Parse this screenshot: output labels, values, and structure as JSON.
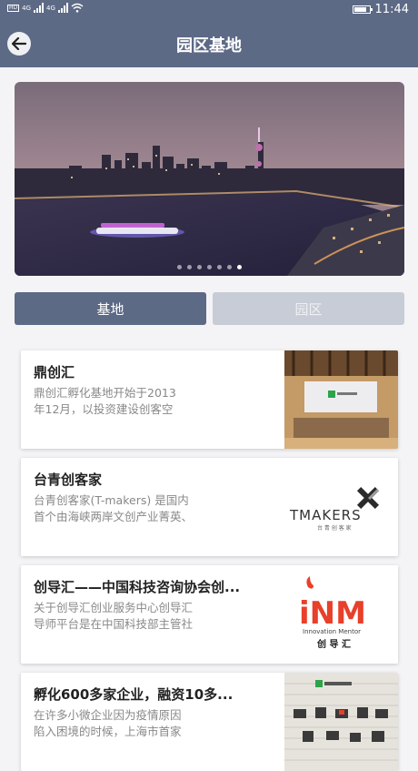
{
  "status_bar": {
    "hd_label": "HD",
    "network_1": "4G",
    "network_2": "4G",
    "time": "11:44"
  },
  "header": {
    "title": "园区基地",
    "back_icon": "arrow-left-icon"
  },
  "banner": {
    "slide_count": 7,
    "active_index": 6
  },
  "tabs": [
    {
      "label": "基地",
      "active": true
    },
    {
      "label": "园区",
      "active": false
    }
  ],
  "cards": [
    {
      "title": "鼎创汇",
      "desc_line1": "鼎创汇孵化基地开始于2013",
      "desc_line2": "年12月，以投资建设创客空"
    },
    {
      "title": "台青创客家",
      "desc_line1": "台青创客家(T-makers) 是国内",
      "desc_line2": "首个由海峡两岸文创产业菁英、",
      "logo_text": "TMAKERS",
      "logo_sub": "台 青 创 客 家"
    },
    {
      "title": "创导汇——中国科技咨询协会创...",
      "desc_line1": "关于创导汇创业服务中心创导汇",
      "desc_line2": "导师平台是在中国科技部主管社",
      "logo_text": "iNM",
      "logo_sub": "Innovation Mentor",
      "logo_cn": "创 导 汇"
    },
    {
      "title": "孵化600多家企业，融资10多...",
      "desc_line1": "在许多小微企业因为疫情原因",
      "desc_line2": "陷入困境的时候，上海市首家"
    }
  ],
  "colors": {
    "primary": "#5d6a86",
    "tab_inactive": "#c8ccd6",
    "logo_red": "#e8402a"
  }
}
